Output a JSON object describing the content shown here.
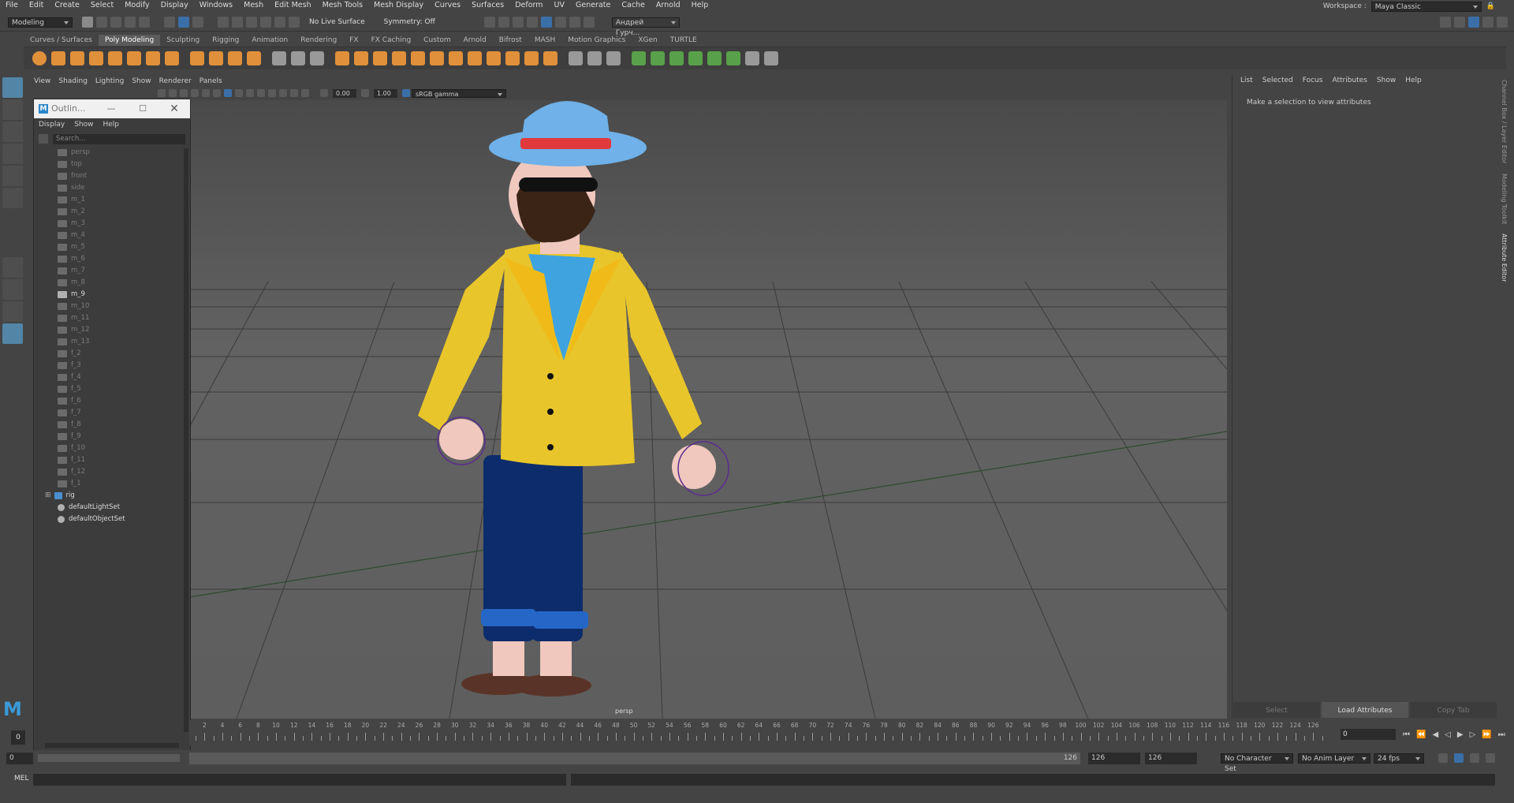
{
  "menubar": {
    "items": [
      "File",
      "Edit",
      "Create",
      "Select",
      "Modify",
      "Display",
      "Windows",
      "Mesh",
      "Edit Mesh",
      "Mesh Tools",
      "Mesh Display",
      "Curves",
      "Surfaces",
      "Deform",
      "UV",
      "Generate",
      "Cache",
      "Arnold",
      "Help"
    ],
    "workspace_label": "Workspace :",
    "workspace_value": "Maya Classic"
  },
  "statusline": {
    "mode": "Modeling",
    "live_surface": "No Live Surface",
    "symmetry": "Symmetry: Off",
    "user": "Андрей Гурч..."
  },
  "shelf": {
    "tabs": [
      "Curves / Surfaces",
      "Poly Modeling",
      "Sculpting",
      "Rigging",
      "Animation",
      "Rendering",
      "FX",
      "FX Caching",
      "Custom",
      "Arnold",
      "Bifrost",
      "MASH",
      "Motion Graphics",
      "XGen",
      "TURTLE"
    ],
    "active_tab": "Poly Modeling"
  },
  "viewport": {
    "menu": [
      "View",
      "Shading",
      "Lighting",
      "Show",
      "Renderer",
      "Panels"
    ],
    "exposure": "0.00",
    "gamma": "1.00",
    "colorspace": "sRGB gamma",
    "camera_label": "persp"
  },
  "outliner": {
    "title": "Outlin...",
    "menu": [
      "Display",
      "Show",
      "Help"
    ],
    "search_placeholder": "Search...",
    "items": [
      {
        "label": "persp",
        "icon": "camera-icon",
        "bright": false
      },
      {
        "label": "top",
        "icon": "camera-icon",
        "bright": false
      },
      {
        "label": "front",
        "icon": "camera-icon",
        "bright": false
      },
      {
        "label": "side",
        "icon": "camera-icon",
        "bright": false
      },
      {
        "label": "m_1",
        "icon": "mesh-icon",
        "bright": false
      },
      {
        "label": "m_2",
        "icon": "mesh-icon",
        "bright": false
      },
      {
        "label": "m_3",
        "icon": "mesh-icon",
        "bright": false
      },
      {
        "label": "m_4",
        "icon": "mesh-icon",
        "bright": false
      },
      {
        "label": "m_5",
        "icon": "mesh-icon",
        "bright": false
      },
      {
        "label": "m_6",
        "icon": "mesh-icon",
        "bright": false
      },
      {
        "label": "m_7",
        "icon": "mesh-icon",
        "bright": false
      },
      {
        "label": "m_8",
        "icon": "mesh-icon",
        "bright": false
      },
      {
        "label": "m_9",
        "icon": "mesh-icon",
        "bright": true
      },
      {
        "label": "m_10",
        "icon": "mesh-icon",
        "bright": false
      },
      {
        "label": "m_11",
        "icon": "mesh-icon",
        "bright": false
      },
      {
        "label": "m_12",
        "icon": "mesh-icon",
        "bright": false
      },
      {
        "label": "m_13",
        "icon": "mesh-icon",
        "bright": false
      },
      {
        "label": "f_2",
        "icon": "mesh-icon",
        "bright": false
      },
      {
        "label": "f_3",
        "icon": "mesh-icon",
        "bright": false
      },
      {
        "label": "f_4",
        "icon": "mesh-icon",
        "bright": false
      },
      {
        "label": "f_5",
        "icon": "mesh-icon",
        "bright": false
      },
      {
        "label": "f_6",
        "icon": "mesh-icon",
        "bright": false
      },
      {
        "label": "f_7",
        "icon": "mesh-icon",
        "bright": false
      },
      {
        "label": "f_8",
        "icon": "mesh-icon",
        "bright": false
      },
      {
        "label": "f_9",
        "icon": "mesh-icon",
        "bright": false
      },
      {
        "label": "f_10",
        "icon": "mesh-icon",
        "bright": false
      },
      {
        "label": "f_11",
        "icon": "mesh-icon",
        "bright": false
      },
      {
        "label": "f_12",
        "icon": "mesh-icon",
        "bright": false
      },
      {
        "label": "f_1",
        "icon": "mesh-icon",
        "bright": false
      },
      {
        "label": "rig",
        "icon": "joint-icon",
        "bright": true
      },
      {
        "label": "defaultLightSet",
        "icon": "set-icon",
        "bright": true
      },
      {
        "label": "defaultObjectSet",
        "icon": "set-icon",
        "bright": true
      }
    ]
  },
  "attribute_editor": {
    "menu": [
      "List",
      "Selected",
      "Focus",
      "Attributes",
      "Show",
      "Help"
    ],
    "message": "Make a selection to view attributes",
    "buttons": [
      "Select",
      "Load Attributes",
      "Copy Tab"
    ],
    "side_tabs": [
      "Channel Box / Layer Editor",
      "Modeling Toolkit",
      "Attribute Editor"
    ]
  },
  "timeline": {
    "current_frame": "0",
    "tick_labels": [
      "2",
      "4",
      "6",
      "8",
      "10",
      "12",
      "14",
      "16",
      "18",
      "20",
      "22",
      "24",
      "26",
      "28",
      "30",
      "32",
      "34",
      "36",
      "38",
      "40",
      "42",
      "44",
      "46",
      "48",
      "50",
      "52",
      "54",
      "56",
      "58",
      "60",
      "62",
      "64",
      "66",
      "68",
      "70",
      "72",
      "74",
      "76",
      "78",
      "80",
      "82",
      "84",
      "86",
      "88",
      "90",
      "92",
      "94",
      "96",
      "98",
      "100",
      "102",
      "104",
      "106",
      "108",
      "110",
      "112",
      "114",
      "116",
      "118",
      "120",
      "122",
      "124",
      "126"
    ]
  },
  "range": {
    "start": "0",
    "inner_start": "0",
    "inner_end": "126",
    "end": "126",
    "end2": "126",
    "character_set": "No Character Set",
    "anim_layer": "No Anim Layer",
    "fps": "24 fps"
  },
  "command_line": {
    "label": "MEL"
  },
  "colors": {
    "accent": "#5285a6",
    "shelf_orange": "#e0903a",
    "jacket": "#e8c52a",
    "shirt": "#3fa3e0",
    "pants": "#0d2c6b",
    "hat": "#6fb1e8",
    "hat_band": "#e03a3a"
  }
}
